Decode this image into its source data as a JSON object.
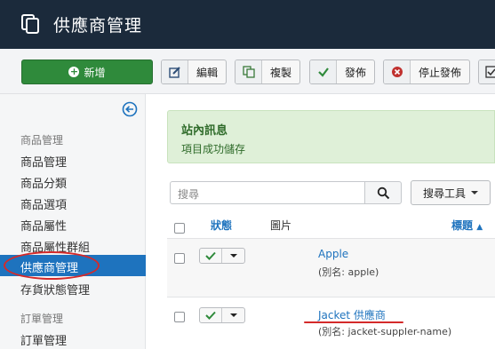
{
  "header": {
    "title": "供應商管理"
  },
  "toolbar": {
    "new_label": "新增",
    "edit_label": "編輯",
    "copy_label": "複製",
    "publish_label": "發佈",
    "unpublish_label": "停止發佈"
  },
  "sidebar": {
    "groups": [
      {
        "heading": "商品管理",
        "items": [
          "商品管理",
          "商品分類",
          "商品選項",
          "商品屬性",
          "商品屬性群組",
          "供應商管理",
          "存貨狀態管理"
        ]
      },
      {
        "heading": "訂單管理",
        "items": [
          "訂單管理"
        ]
      }
    ],
    "active_item": "供應商管理"
  },
  "alert": {
    "heading": "站內訊息",
    "message": "項目成功儲存"
  },
  "search": {
    "placeholder": "搜尋",
    "tools_label": "搜尋工具"
  },
  "table": {
    "headers": {
      "status": "狀態",
      "image": "圖片",
      "title": "標題"
    },
    "rows": [
      {
        "name": "Apple",
        "alias": "(別名: apple)"
      },
      {
        "name": "Jacket 供應商",
        "alias": "(別名: jacket-suppler-name)"
      }
    ]
  },
  "colors": {
    "header_bg": "#1b2a3b",
    "primary": "#1e73be",
    "success": "#2f8a3b",
    "annotation": "#d42a2a"
  }
}
